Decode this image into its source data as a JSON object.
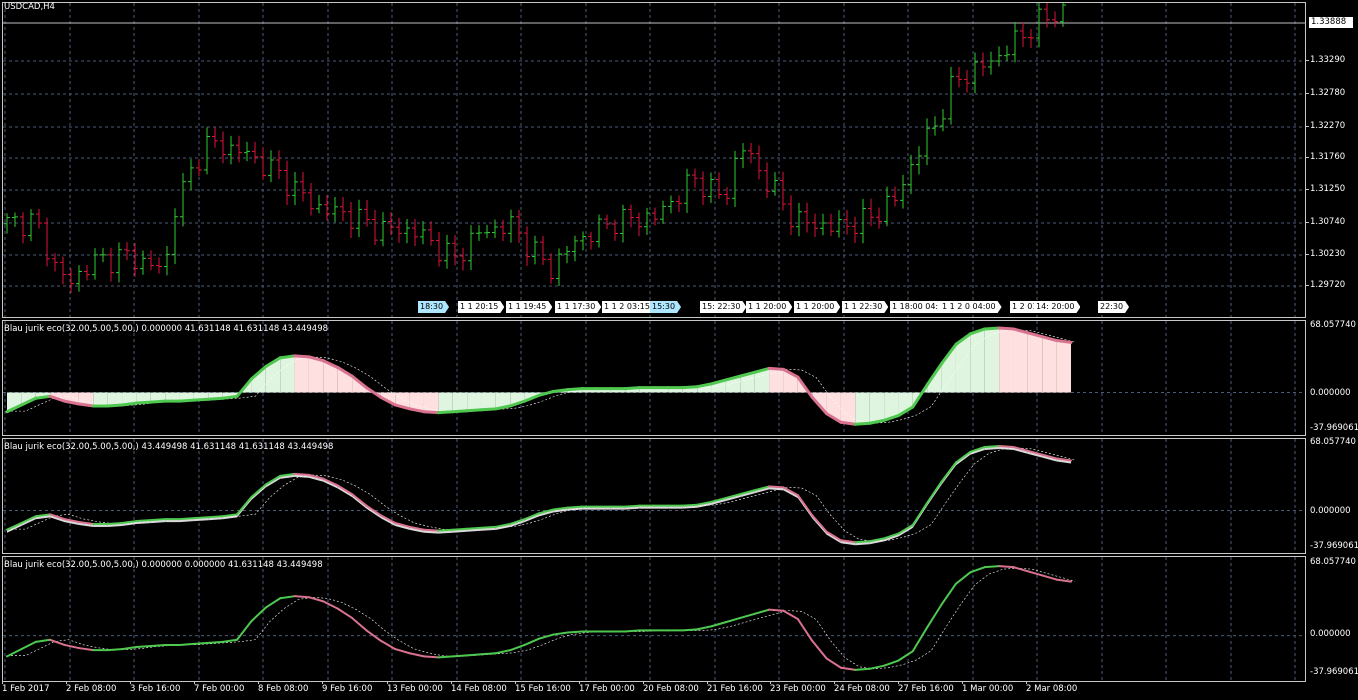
{
  "chart": {
    "symbol": "USDCAD,H4",
    "current_price": "1.33888",
    "price_axis": [
      "1.33290",
      "1.32780",
      "1.32270",
      "1.31760",
      "1.31250",
      "1.30740",
      "1.30230",
      "1.29720"
    ],
    "session_labels": [
      {
        "text": "18:30",
        "cyan": true
      },
      {
        "text": "1 1 20:15",
        "cyan": false
      },
      {
        "text": "1 1 19:45",
        "cyan": false
      },
      {
        "text": "1 1 17:30",
        "cyan": false
      },
      {
        "text": "1 1 2 03:15",
        "cyan": false
      },
      {
        "text": "15:30",
        "cyan": true
      },
      {
        "text": "15: 22:30",
        "cyan": false
      },
      {
        "text": "1 1 20:00",
        "cyan": false
      },
      {
        "text": "1 1 20:00",
        "cyan": false
      },
      {
        "text": "1 1 22:30",
        "cyan": false
      },
      {
        "text": "1 18:00 04:",
        "cyan": false
      },
      {
        "text": "1 1 2 0 04:00",
        "cyan": false
      },
      {
        "text": "1 2 01:00",
        "cyan": false
      },
      {
        "text": "14: 20:00",
        "cyan": false
      },
      {
        "text": "22:30",
        "cyan": false
      }
    ]
  },
  "indicators": [
    {
      "label": "Blau jurik eco(32.00,5.00,5.00,) 0.000000 41.631148 41.631148 43.449498",
      "axis_top": "68.057740",
      "axis_zero": "0.000000",
      "axis_bottom": "-37.969061"
    },
    {
      "label": "Blau jurik eco(32.00,5.00,5.00,) 43.449498 41.631148 41.631148 43.449498",
      "axis_top": "68.057740",
      "axis_zero": "0.000000",
      "axis_bottom": "-37.969061"
    },
    {
      "label": "Blau jurik eco(32.00,5.00,5.00,) 0.000000 0.000000 41.631148 43.449498",
      "axis_top": "68.057740",
      "axis_zero": "0.000000",
      "axis_bottom": "-37.969061"
    }
  ],
  "time_axis": [
    "1 Feb 2017",
    "2 Feb 08:00",
    "3 Feb 16:00",
    "7 Feb 00:00",
    "8 Feb 08:00",
    "9 Feb 16:00",
    "13 Feb 00:00",
    "14 Feb 08:00",
    "15 Feb 16:00",
    "17 Feb 00:00",
    "20 Feb 08:00",
    "21 Feb 16:00",
    "23 Feb 00:00",
    "24 Feb 08:00",
    "27 Feb 16:00",
    "1 Mar 00:00",
    "2 Mar 08:00"
  ],
  "chart_data": {
    "type": "line",
    "title": "USDCAD,H4",
    "colors": {
      "bull": "#32cd32",
      "bear": "#dc143c",
      "ind_up": "#4fc84f",
      "ind_down": "#d9728f",
      "fill_up": "#dff5df",
      "fill_down": "#ffe0e0"
    },
    "y_range": [
      1.295,
      1.34
    ],
    "ind_range": [
      -37.969061,
      68.05774
    ],
    "indicator_values": [
      -20,
      -13,
      -6,
      -4,
      -9,
      -12,
      -14,
      -14,
      -13,
      -11,
      -10,
      -9,
      -9,
      -8,
      -7,
      -6,
      -4,
      14,
      27,
      36,
      38,
      37,
      33,
      26,
      17,
      5,
      -5,
      -13,
      -17,
      -20,
      -21,
      -20,
      -19,
      -18,
      -17,
      -14,
      -9,
      -3,
      1,
      3,
      4,
      4,
      4,
      4,
      5,
      5,
      5,
      5,
      6,
      9,
      13,
      17,
      21,
      25,
      24,
      16,
      -5,
      -22,
      -31,
      -33,
      -32,
      -29,
      -24,
      -15,
      8,
      30,
      50,
      61,
      66,
      67,
      66,
      62,
      58,
      54,
      52
    ]
  }
}
